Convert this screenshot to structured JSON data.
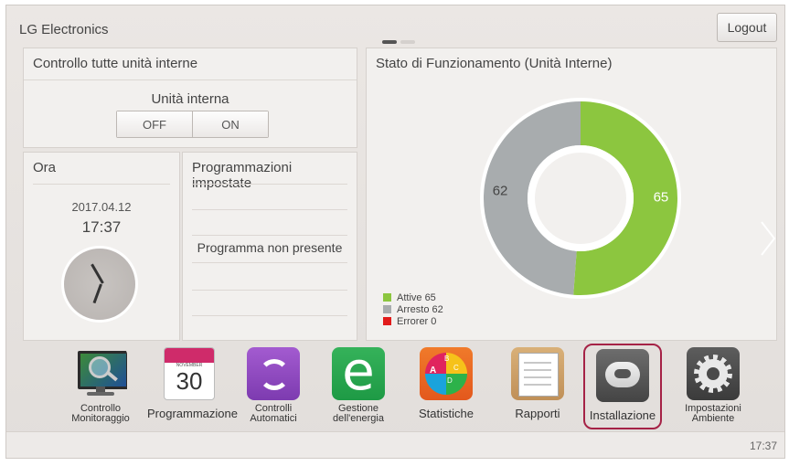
{
  "header": {
    "brand": "LG Electronics",
    "logout": "Logout"
  },
  "control_panel": {
    "title": "Controllo tutte unità interne",
    "unit_label": "Unità interna",
    "off": "OFF",
    "on": "ON"
  },
  "time_panel": {
    "title": "Ora",
    "date": "2017.04.12",
    "time": "17:37"
  },
  "schedule_panel": {
    "title": "Programmazioni impostate",
    "empty_text": "Programma non presente"
  },
  "status_panel": {
    "title": "Stato di Funzionamento (Unità Interne)",
    "legend": [
      "Attive 65",
      "Arresto 62",
      "Errorer 0"
    ]
  },
  "chart_data": {
    "type": "pie",
    "categories": [
      "Attive",
      "Arresto",
      "Errorer"
    ],
    "values": [
      65,
      62,
      0
    ],
    "colors": [
      "#8cc63f",
      "#a8acae",
      "#e11b1b"
    ],
    "labels": [
      "65",
      "62",
      ""
    ]
  },
  "apps": [
    {
      "label": "Controllo Monitoraggio",
      "icon": "monitor-search-icon"
    },
    {
      "label": "Programmazione",
      "icon": "calendar-icon",
      "month": "NOVEMBER",
      "day": "30"
    },
    {
      "label": "Controlli Automatici",
      "icon": "auto-cycle-icon"
    },
    {
      "label": "Gestione dell'energia",
      "icon": "energy-e-icon"
    },
    {
      "label": "Statistiche",
      "icon": "statistics-pie-icon",
      "letters": [
        "A",
        "B",
        "C",
        "D"
      ]
    },
    {
      "label": "Rapporti",
      "icon": "report-clipboard-icon"
    },
    {
      "label": "Installazione",
      "icon": "ceiling-cassette-icon"
    },
    {
      "label": "Impostazioni Ambiente",
      "icon": "gear-icon"
    }
  ],
  "footer": {
    "time": "17:37"
  }
}
